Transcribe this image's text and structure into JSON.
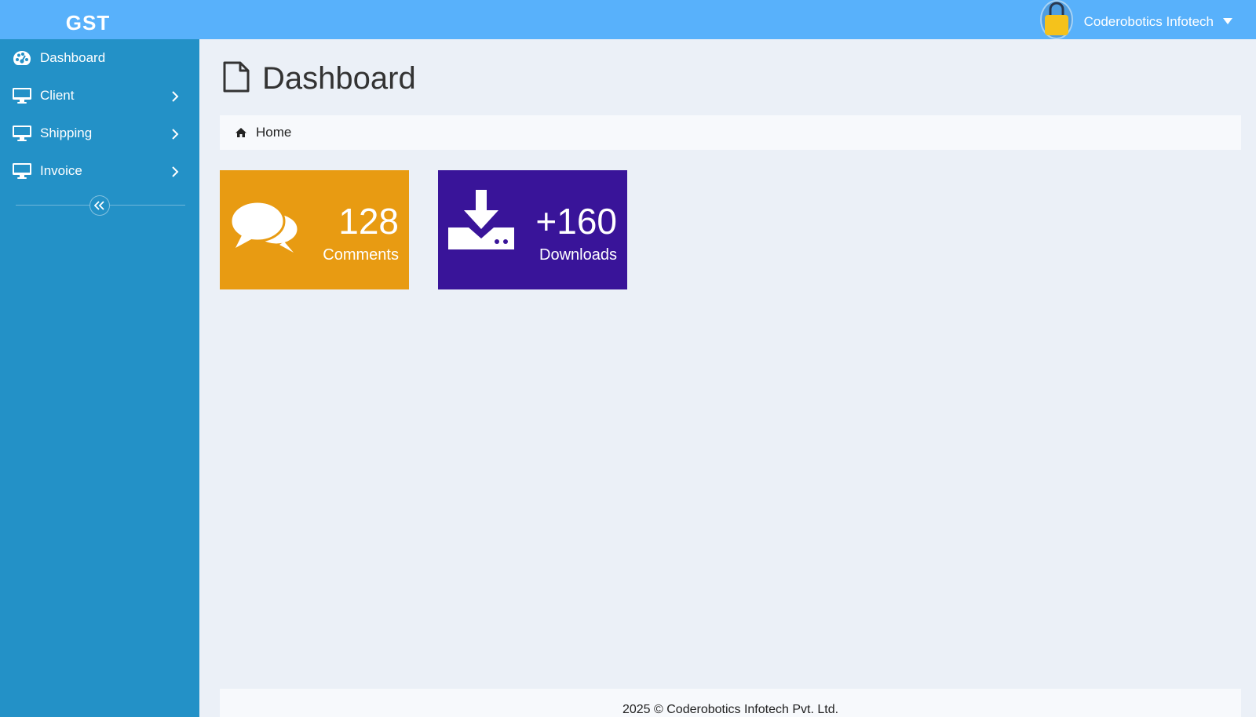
{
  "app": {
    "brand": "GST"
  },
  "user": {
    "name": "Coderobotics Infotech"
  },
  "sidebar": {
    "items": [
      {
        "label": "Dashboard",
        "icon": "palette-icon"
      },
      {
        "label": "Client",
        "icon": "monitor-icon"
      },
      {
        "label": "Shipping",
        "icon": "monitor-icon"
      },
      {
        "label": "Invoice",
        "icon": "monitor-icon"
      }
    ]
  },
  "page": {
    "title": "Dashboard"
  },
  "breadcrumb": {
    "home": "Home"
  },
  "tiles": [
    {
      "value": "128",
      "label": "Comments",
      "color": "#e89b12",
      "icon": "comments-icon"
    },
    {
      "value": "+160",
      "label": "Downloads",
      "color": "#391499",
      "icon": "download-icon"
    }
  ],
  "footer": {
    "text": "2025 © Coderobotics Infotech Pvt. Ltd."
  },
  "colors": {
    "topbar": "#58b1fb",
    "sidebar": "#2391c7",
    "background": "#ebf0f7"
  }
}
